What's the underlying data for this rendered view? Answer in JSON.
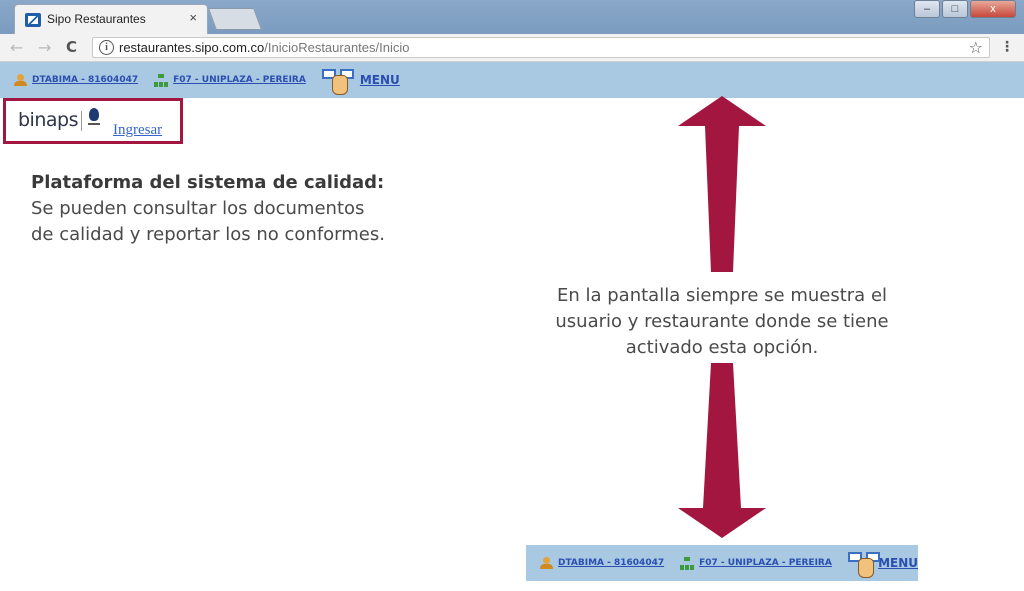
{
  "browser": {
    "tab_title": "Sipo Restaurantes",
    "tab_close": "×",
    "url_host": "restaurantes.sipo.com.co",
    "url_path": "/InicioRestaurantes/Inicio",
    "back": "←",
    "forward": "→",
    "reload": "C",
    "star": "☆",
    "menu": "⋮",
    "window_buttons": {
      "minimize": "–",
      "maximize": "□",
      "close": "x"
    }
  },
  "userbar": {
    "user": "DTABIMA - 81604047",
    "restaurant": "F07 - UNIPLAZA - PEREIRA",
    "menu": "MENU"
  },
  "binaps": {
    "logo_text": "binaps",
    "login": "Ingresar"
  },
  "description": {
    "title": "Plataforma del sistema de calidad:",
    "line1": "Se pueden consultar los documentos",
    "line2": "de calidad y reportar los no conformes."
  },
  "note": {
    "line1": "En la pantalla siempre se muestra el",
    "line2": "usuario y restaurante donde se tiene",
    "line3": "activado esta opción."
  },
  "colors": {
    "accent": "#a3163f",
    "bar": "#a9c8e2",
    "link": "#2a4fb0"
  }
}
